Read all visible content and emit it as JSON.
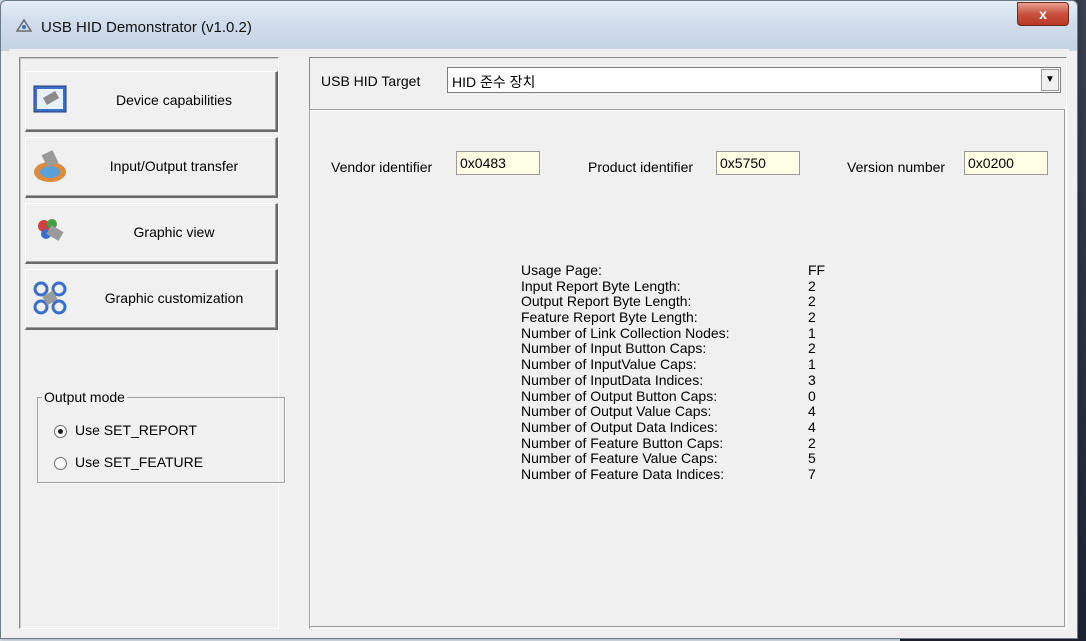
{
  "window": {
    "title": "USB HID Demonstrator (v1.0.2)",
    "close_label": "x"
  },
  "sidebar": {
    "buttons": [
      {
        "label": "Device capabilities",
        "icon": "device-capabilities-icon"
      },
      {
        "label": "Input/Output transfer",
        "icon": "io-transfer-icon"
      },
      {
        "label": "Graphic view",
        "icon": "graphic-view-icon"
      },
      {
        "label": "Graphic customization",
        "icon": "graphic-customization-icon"
      }
    ],
    "output_mode": {
      "legend": "Output mode",
      "options": [
        {
          "label": "Use SET_REPORT",
          "selected": true
        },
        {
          "label": "Use SET_FEATURE",
          "selected": false
        }
      ]
    }
  },
  "target": {
    "label": "USB HID Target",
    "value": "HID 준수 장치"
  },
  "ids": {
    "vendor_label": "Vendor identifier",
    "vendor_value": "0x0483",
    "product_label": "Product identifier",
    "product_value": "0x5750",
    "version_label": "Version number",
    "version_value": "0x0200"
  },
  "capabilities": [
    {
      "k": "Usage Page:",
      "v": "FF"
    },
    {
      "k": "Input Report Byte Length:",
      "v": "2"
    },
    {
      "k": "Output Report Byte Length:",
      "v": "2"
    },
    {
      "k": "Feature Report Byte Length:",
      "v": "2"
    },
    {
      "k": "Number of Link Collection Nodes:",
      "v": "1"
    },
    {
      "k": "Number of Input Button Caps:",
      "v": "2"
    },
    {
      "k": "Number of InputValue Caps:",
      "v": "1"
    },
    {
      "k": "Number of InputData Indices:",
      "v": "3"
    },
    {
      "k": "Number of Output Button Caps:",
      "v": "0"
    },
    {
      "k": "Number of Output Value Caps:",
      "v": "4"
    },
    {
      "k": "Number of Output Data Indices:",
      "v": "4"
    },
    {
      "k": "Number of Feature Button Caps:",
      "v": "2"
    },
    {
      "k": "Number of Feature Value Caps:",
      "v": "5"
    },
    {
      "k": "Number of Feature Data Indices:",
      "v": "7"
    }
  ]
}
